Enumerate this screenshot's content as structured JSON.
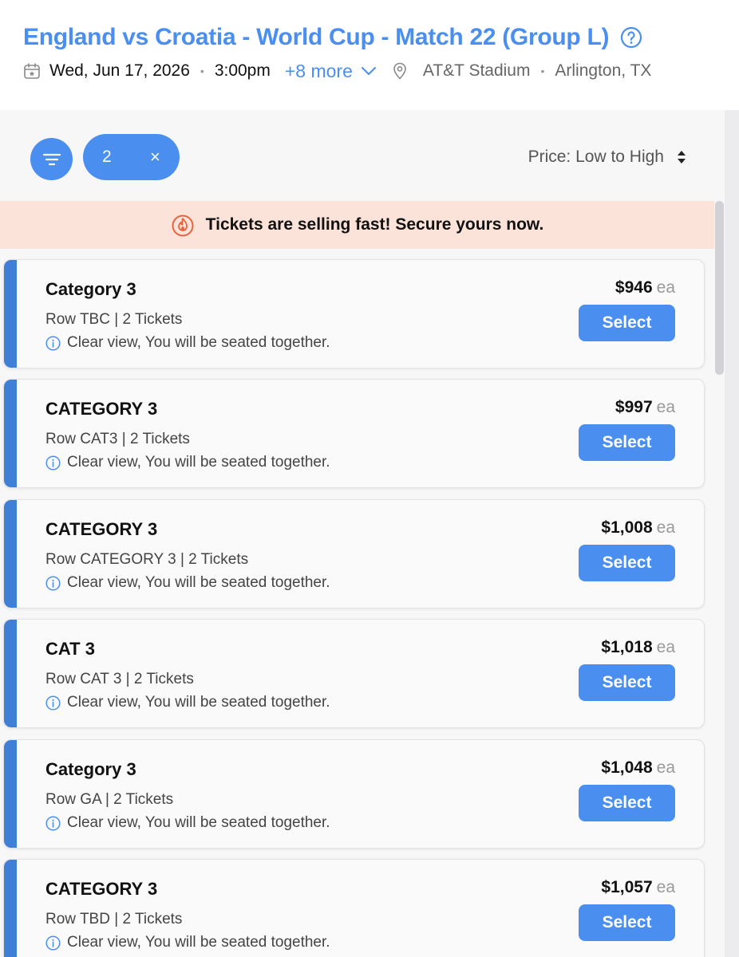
{
  "header": {
    "title": "England vs Croatia - World Cup - Match 22 (Group L)",
    "date": "Wed, Jun 17, 2026",
    "time": "3:00pm",
    "more_link": "+8 more",
    "venue": "AT&T Stadium",
    "city": "Arlington, TX"
  },
  "toolbar": {
    "quantity": "2",
    "clear_symbol": "×",
    "sort_label": "Price: Low to High"
  },
  "banner": {
    "text": "Tickets are selling fast! Secure yours now."
  },
  "colors": {
    "accent": "#4a8ff0",
    "card_accent": "#3f7fd6",
    "banner_bg": "#fbe3d9",
    "fire": "#e8623a"
  },
  "listings": [
    {
      "name": "Category 3",
      "row": "Row TBC | 2 Tickets",
      "info": "Clear view,  You will be seated together.",
      "price": "$946",
      "unit": "ea",
      "button": "Select"
    },
    {
      "name": "CATEGORY 3",
      "row": "Row CAT3 | 2 Tickets",
      "info": "Clear view,  You will be seated together.",
      "price": "$997",
      "unit": "ea",
      "button": "Select"
    },
    {
      "name": "CATEGORY 3",
      "row": "Row CATEGORY 3 | 2 Tickets",
      "info": "Clear view,  You will be seated together.",
      "price": "$1,008",
      "unit": "ea",
      "button": "Select"
    },
    {
      "name": "CAT 3",
      "row": "Row CAT 3 | 2 Tickets",
      "info": "Clear view,  You will be seated together.",
      "price": "$1,018",
      "unit": "ea",
      "button": "Select"
    },
    {
      "name": "Category 3",
      "row": "Row GA | 2 Tickets",
      "info": "Clear view,  You will be seated together.",
      "price": "$1,048",
      "unit": "ea",
      "button": "Select"
    },
    {
      "name": "CATEGORY 3",
      "row": "Row TBD | 2 Tickets",
      "info": "Clear view,  You will be seated together.",
      "price": "$1,057",
      "unit": "ea",
      "button": "Select"
    }
  ]
}
